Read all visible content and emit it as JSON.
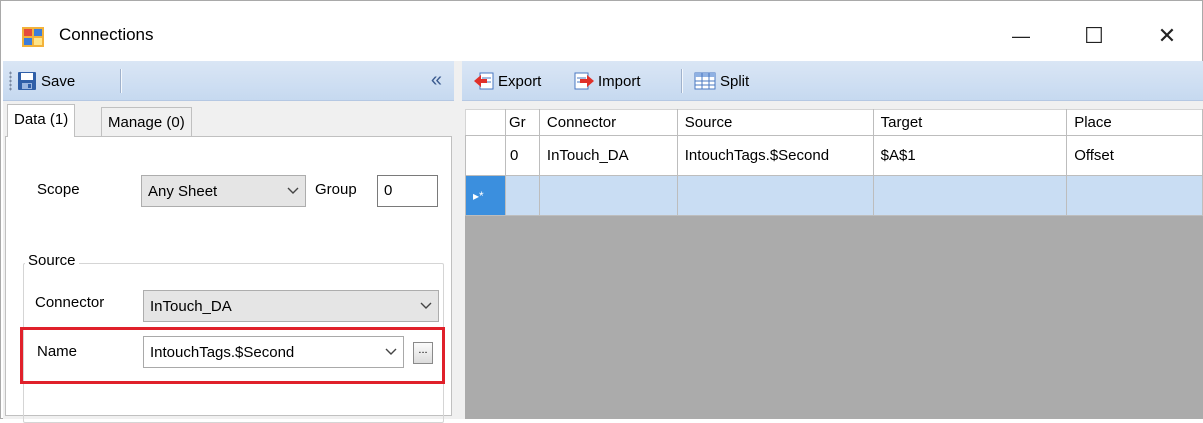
{
  "window": {
    "title": "Connections",
    "minimize_glyph": "—",
    "maximize_glyph": "☐",
    "close_glyph": "✕"
  },
  "left_toolbar": {
    "save_label": "Save",
    "collapse_glyph": "«"
  },
  "tabs": [
    {
      "label": "Data (1)",
      "active": true
    },
    {
      "label": "Manage (0)",
      "active": false
    }
  ],
  "form": {
    "scope_label": "Scope",
    "scope_value": "Any Sheet",
    "group_label": "Group",
    "group_value": "0",
    "source_group_title": "Source",
    "connector_label": "Connector",
    "connector_value": "InTouch_DA",
    "name_label": "Name",
    "name_value": "IntouchTags.$Second",
    "browse_label": "..."
  },
  "right_toolbar": {
    "export_label": "Export",
    "import_label": "Import",
    "split_label": "Split"
  },
  "grid": {
    "columns": [
      "Gr",
      "Connector",
      "Source",
      "Target",
      "Place"
    ],
    "rows": [
      {
        "group": "0",
        "connector": "InTouch_DA",
        "source": "IntouchTags.$Second",
        "target": "$A$1",
        "place": "Offset"
      }
    ],
    "new_row_marker": "▸*"
  },
  "colors": {
    "toolbar_blue": "#c6d9f0",
    "new_row_blue": "#c9ddf3",
    "row_header_selected": "#3b8fde",
    "highlight_red": "#e0202a"
  }
}
